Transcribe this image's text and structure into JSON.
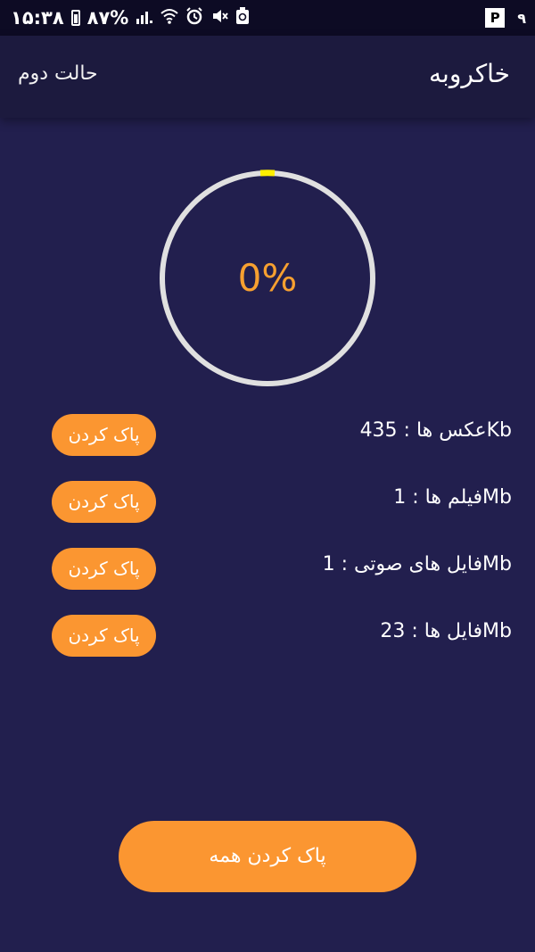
{
  "status_bar": {
    "time": "۱۵:۳۸",
    "battery": "۸۷%",
    "app_badge": "P",
    "digit": "۹"
  },
  "app_bar": {
    "title": "خاکروبه",
    "mode_link": "حالت دوم"
  },
  "progress": {
    "percent_text": "0%",
    "value": 0
  },
  "items": [
    {
      "label": "عکس ها : 435Kb",
      "button": "پاک کردن"
    },
    {
      "label": "فیلم ها : 1Mb",
      "button": "پاک کردن"
    },
    {
      "label": "فایل های صوتی : 1Mb",
      "button": "پاک کردن"
    },
    {
      "label": "فایل ها : 23Mb",
      "button": "پاک کردن"
    }
  ],
  "clean_all_button": "پاک کردن همه",
  "colors": {
    "background": "#221f4e",
    "app_bar": "#1c1a3e",
    "accent": "#fb9631",
    "progress_text": "#f7a030",
    "ring_track": "#e0e0e0",
    "ring_marker": "#ffee00"
  }
}
